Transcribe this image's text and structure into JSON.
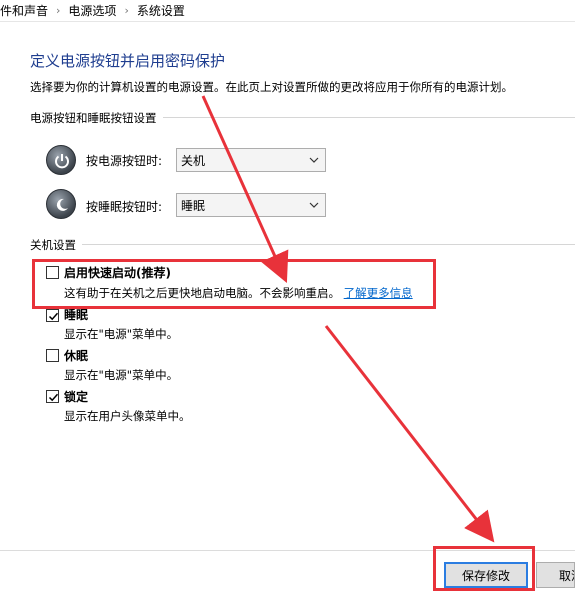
{
  "breadcrumb": {
    "items": [
      "件和声音",
      "电源选项",
      "系统设置"
    ],
    "separator": "›"
  },
  "page": {
    "title": "定义电源按钮并启用密码保护",
    "description": "选择要为你的计算机设置的电源设置。在此页上对设置所做的更改将应用于你所有的电源计划。"
  },
  "power_group": {
    "label": "电源按钮和睡眠按钮设置",
    "power_button": {
      "label": "按电源按钮时:",
      "value": "关机"
    },
    "sleep_button": {
      "label": "按睡眠按钮时:",
      "value": "睡眠"
    }
  },
  "shutdown_group": {
    "label": "关机设置",
    "options": [
      {
        "label": "启用快速启动(推荐)",
        "checked": false,
        "desc": "这有助于在关机之后更快地启动电脑。不会影响重启。",
        "link": "了解更多信息"
      },
      {
        "label": "睡眠",
        "checked": true,
        "desc": "显示在\"电源\"菜单中。"
      },
      {
        "label": "休眠",
        "checked": false,
        "desc": "显示在\"电源\"菜单中。"
      },
      {
        "label": "锁定",
        "checked": true,
        "desc": "显示在用户头像菜单中。"
      }
    ]
  },
  "buttons": {
    "save": "保存修改",
    "cancel": "取消"
  },
  "colors": {
    "title": "#1e3d8f",
    "link": "#0066cc",
    "annotation": "#e8323a",
    "primary_border": "#2b7de1"
  }
}
